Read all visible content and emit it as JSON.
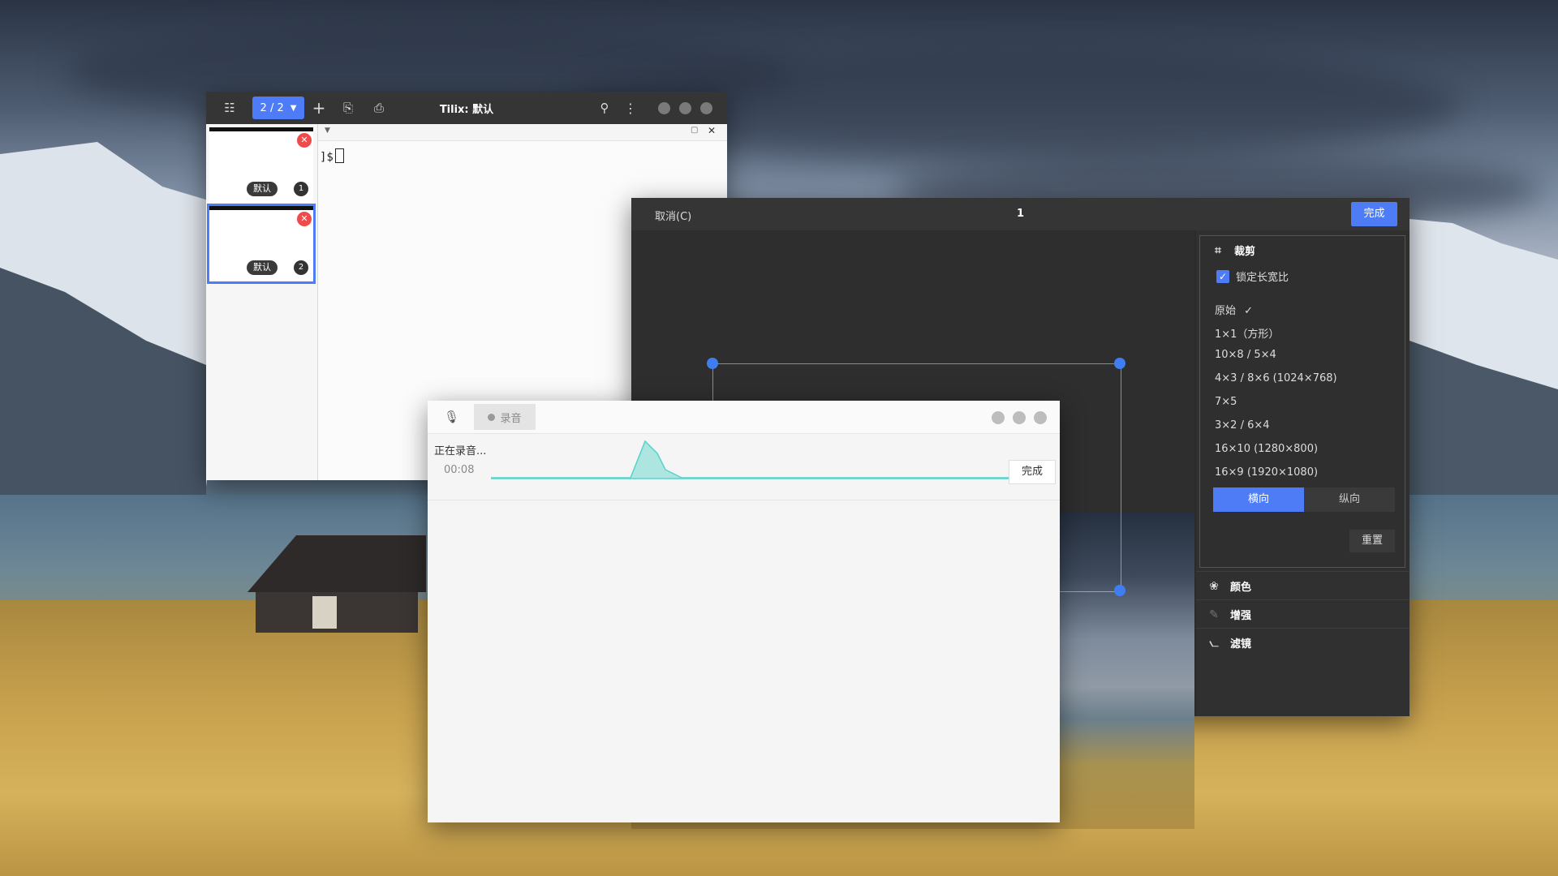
{
  "tilix": {
    "session_indicator": "2 / 2",
    "title": "Tilix: 默认",
    "prompt": "]$",
    "sessions": [
      {
        "label": "默认",
        "number": "1"
      },
      {
        "label": "默认",
        "number": "2"
      }
    ]
  },
  "editor": {
    "cancel_label": "取消(C)",
    "title": "1",
    "done_label": "完成",
    "crop": {
      "heading": "裁剪",
      "lock_ratio_label": "锁定长宽比",
      "ratios": [
        "原始",
        "1×1（方形）",
        "10×8 / 5×4",
        "4×3 / 8×6 (1024×768)",
        "7×5",
        "3×2 / 6×4",
        "16×10 (1280×800)",
        "16×9 (1920×1080)"
      ],
      "selected_ratio_mark": "✓",
      "landscape_label": "横向",
      "portrait_label": "纵向",
      "reset_label": "重置"
    },
    "sections": {
      "color": "颜色",
      "enhance": "增强",
      "filter": "滤镜"
    }
  },
  "recorder": {
    "tab_label": "录音",
    "status": "正在录音...",
    "time": "00:08",
    "done_label": "完成"
  },
  "colors": {
    "accent": "#4d7cf6",
    "waveform": "#56d3c9"
  }
}
